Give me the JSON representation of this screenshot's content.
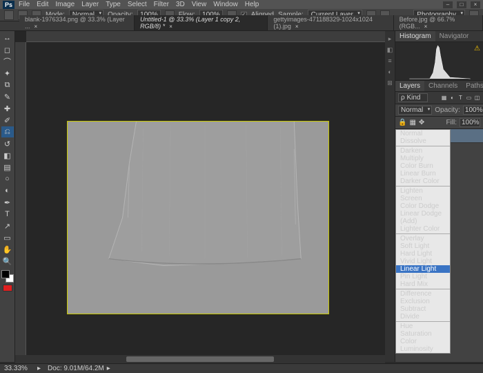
{
  "menu": [
    "File",
    "Edit",
    "Image",
    "Layer",
    "Type",
    "Select",
    "Filter",
    "3D",
    "View",
    "Window",
    "Help"
  ],
  "logo": "Ps",
  "winctrl": [
    "–",
    "□",
    "×"
  ],
  "optbar": {
    "mode_lbl": "Mode:",
    "mode_val": "Normal",
    "opacity_lbl": "Opacity:",
    "opacity_val": "100%",
    "flow_lbl": "Flow:",
    "flow_val": "100%",
    "aligned_lbl": "Aligned",
    "sample_lbl": "Sample:",
    "sample_val": "Current Layer",
    "workspace": "Photography"
  },
  "tabs": [
    {
      "label": "blank-1976334.png @ 33.3% (Layer ...",
      "active": false
    },
    {
      "label": "Untitled-1 @ 33.3% (Layer 1 copy 2, RGB/8) *",
      "active": true
    },
    {
      "label": "gettyimages-471188329-1024x1024 (1).jpg",
      "active": false
    },
    {
      "label": "Before.jpg @ 66.7% (RGB...",
      "active": false
    }
  ],
  "tools": [
    {
      "n": "move-tool",
      "g": "↔"
    },
    {
      "n": "marquee-tool",
      "g": "◻"
    },
    {
      "n": "lasso-tool",
      "g": "⌒"
    },
    {
      "n": "wand-tool",
      "g": "✦"
    },
    {
      "n": "crop-tool",
      "g": "⧉"
    },
    {
      "n": "eyedropper-tool",
      "g": "✎"
    },
    {
      "n": "heal-tool",
      "g": "✚"
    },
    {
      "n": "brush-tool",
      "g": "✐"
    },
    {
      "n": "stamp-tool",
      "g": "⎌",
      "sel": true
    },
    {
      "n": "history-brush-tool",
      "g": "↺"
    },
    {
      "n": "eraser-tool",
      "g": "◧"
    },
    {
      "n": "gradient-tool",
      "g": "▤"
    },
    {
      "n": "blur-tool",
      "g": "○"
    },
    {
      "n": "dodge-tool",
      "g": "◐"
    },
    {
      "n": "pen-tool",
      "g": "✒"
    },
    {
      "n": "type-tool",
      "g": "T"
    },
    {
      "n": "path-tool",
      "g": "↗"
    },
    {
      "n": "shape-tool",
      "g": "▭"
    },
    {
      "n": "hand-tool",
      "g": "✋"
    },
    {
      "n": "zoom-tool",
      "g": "🔍"
    }
  ],
  "panels": {
    "histo_tabs": [
      "Histogram",
      "Navigator"
    ],
    "layer_tabs": [
      "Layers",
      "Channels",
      "Paths"
    ],
    "kind_lbl": "ρ Kind",
    "blend_current": "Normal",
    "opacity_lbl": "Opacity:",
    "opacity_val": "100%",
    "fill_lbl": "Fill:",
    "fill_val": "100%"
  },
  "blend_modes": [
    [
      "Normal",
      "Dissolve"
    ],
    [
      "Darken",
      "Multiply",
      "Color Burn",
      "Linear Burn",
      "Darker Color"
    ],
    [
      "Lighten",
      "Screen",
      "Color Dodge",
      "Linear Dodge (Add)",
      "Lighter Color"
    ],
    [
      "Overlay",
      "Soft Light",
      "Hard Light",
      "Vivid Light",
      "Linear Light",
      "Pin Light",
      "Hard Mix"
    ],
    [
      "Difference",
      "Exclusion",
      "Subtract",
      "Divide"
    ],
    [
      "Hue",
      "Saturation",
      "Color",
      "Luminosity"
    ]
  ],
  "blend_selected": "Linear Light",
  "status": {
    "zoom": "33.33%",
    "doc": "Doc: 9.01M/64.2M"
  }
}
